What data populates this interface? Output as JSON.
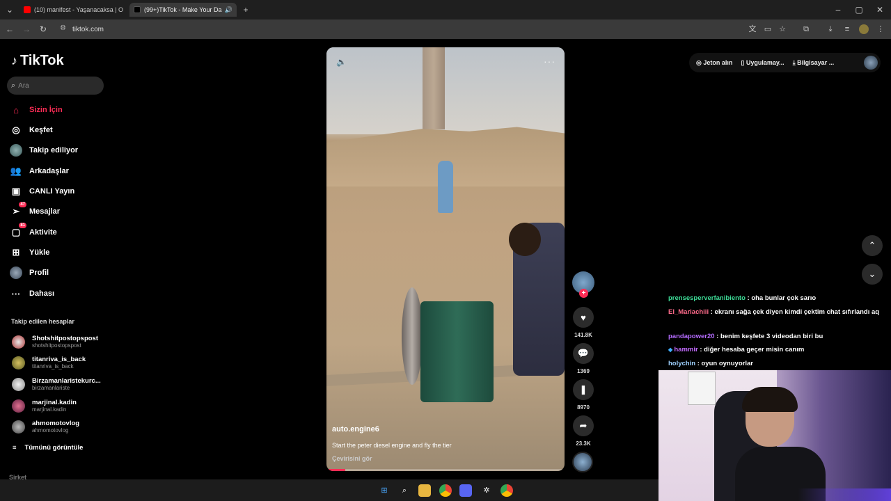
{
  "browser": {
    "tabs": [
      {
        "title": "(10) manifest - Yaşanacaksa | O",
        "icon": "youtube-icon",
        "color": "#ff0000",
        "active": false
      },
      {
        "title": "(99+)TikTok - Make Your Da",
        "icon": "tiktok-icon",
        "color": "#000000",
        "active": true
      }
    ],
    "url": "tiktok.com"
  },
  "sidebar": {
    "logo": "TikTok",
    "search_placeholder": "Ara",
    "items": [
      {
        "label": "Sizin İçin",
        "icon": "home-icon",
        "active": true
      },
      {
        "label": "Keşfet",
        "icon": "compass-icon"
      },
      {
        "label": "Takip ediliyor",
        "icon": "following-avatar-icon"
      },
      {
        "label": "Arkadaşlar",
        "icon": "friends-icon"
      },
      {
        "label": "CANLI Yayın",
        "icon": "live-icon"
      },
      {
        "label": "Mesajlar",
        "icon": "messages-icon",
        "badge": "47"
      },
      {
        "label": "Aktivite",
        "icon": "activity-icon",
        "badge": "81"
      },
      {
        "label": "Yükle",
        "icon": "upload-icon"
      },
      {
        "label": "Profil",
        "icon": "profile-avatar-icon"
      },
      {
        "label": "Dahası",
        "icon": "more-icon"
      }
    ],
    "following_title": "Takip edilen hesaplar",
    "following": [
      {
        "name": "Shotshitpostopspost",
        "handle": "shotshitpostopspost"
      },
      {
        "name": "titanriva_is_back",
        "handle": "titanriva_is_back"
      },
      {
        "name": "Birzamanlaristekurc...",
        "handle": "birzamanlariste"
      },
      {
        "name": "marjinal.kadin",
        "handle": "marjinal.kadin"
      },
      {
        "name": "ahmomotovlog",
        "handle": "ahmomotovlog"
      }
    ],
    "see_all": "Tümünü görüntüle",
    "company": "Şirket"
  },
  "video": {
    "author": "auto.engine6",
    "caption": "Start the peter diesel engine and fly the tier",
    "translate": "Çevirisini gör",
    "progress": 0.08
  },
  "actions": {
    "likes": "141.8K",
    "comments": "1369",
    "saves": "8970",
    "shares": "23.3K"
  },
  "topright": {
    "coins": "Jeton alın",
    "app": "Uygulamay...",
    "desktop": "Bilgisayar ..."
  },
  "chat": [
    {
      "user": "prensesperverfanibiento",
      "color": "#3ddc97",
      "text": ": oha bunlar çok sarıo"
    },
    {
      "user": "El_Mariachiii",
      "color": "#ff6b8b",
      "text": ": ekranı sağa çek diyen kimdi çektim chat sıfırlandı aq"
    },
    {
      "user": "pandapower20",
      "color": "#b56cff",
      "text": ": benim keşfete 3 videodan biri bu"
    },
    {
      "user": "hammir",
      "color": "#c46cff",
      "text": ": diğer hesaba geçer misin canım"
    },
    {
      "user": "holychin",
      "color": "#9fd1ff",
      "text": ": oyun oynuyorlar"
    }
  ]
}
